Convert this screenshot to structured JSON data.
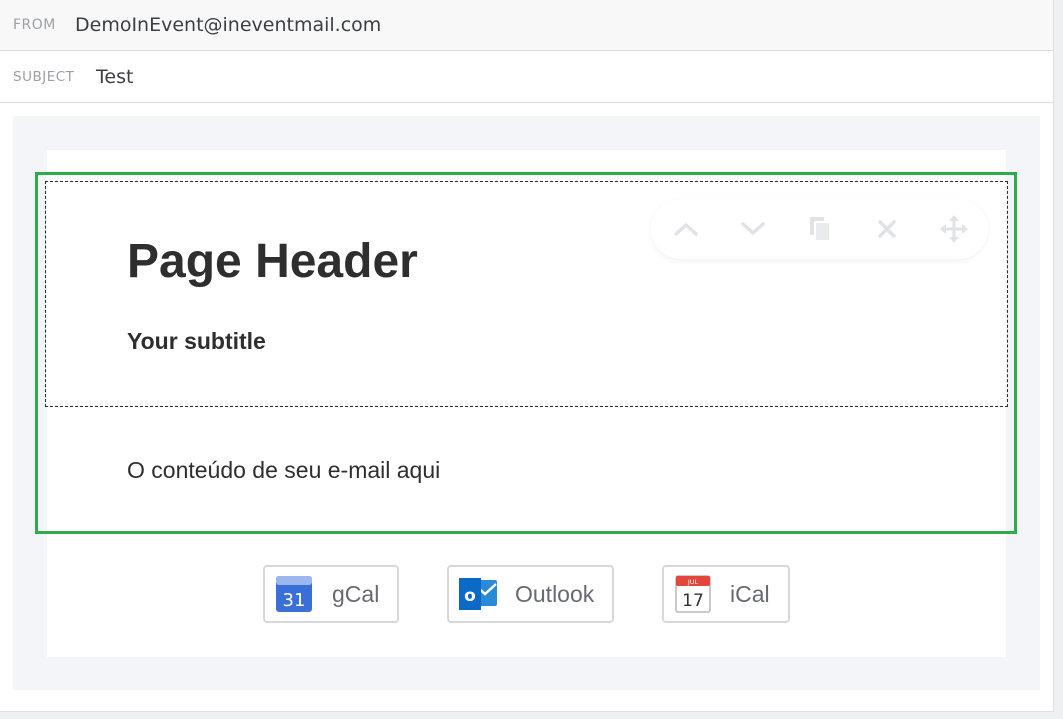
{
  "header": {
    "from_label": "FROM",
    "from_value": "DemoInEvent@ineventmail.com",
    "subject_label": "SUBJECT",
    "subject_value": "Test"
  },
  "email": {
    "page_header": "Page Header",
    "subtitle": "Your subtitle",
    "body_text": "O conteúdo de seu e-mail aqui"
  },
  "block_toolbar": {
    "icons": [
      "chevron-up-icon",
      "chevron-down-icon",
      "copy-icon",
      "close-icon",
      "move-icon"
    ]
  },
  "calendar_buttons": [
    {
      "label": "gCal",
      "icon": "google-calendar-icon",
      "icon_number": "31"
    },
    {
      "label": "Outlook",
      "icon": "outlook-icon",
      "icon_letter": "o"
    },
    {
      "label": "iCal",
      "icon": "apple-calendar-icon",
      "icon_month": "JUL",
      "icon_number": "17"
    }
  ],
  "colors": {
    "selection_border": "#2eac4c",
    "gcal_blue": "#3b6fd8",
    "outlook_blue": "#0b6ac6",
    "ical_red": "#e2463c"
  }
}
